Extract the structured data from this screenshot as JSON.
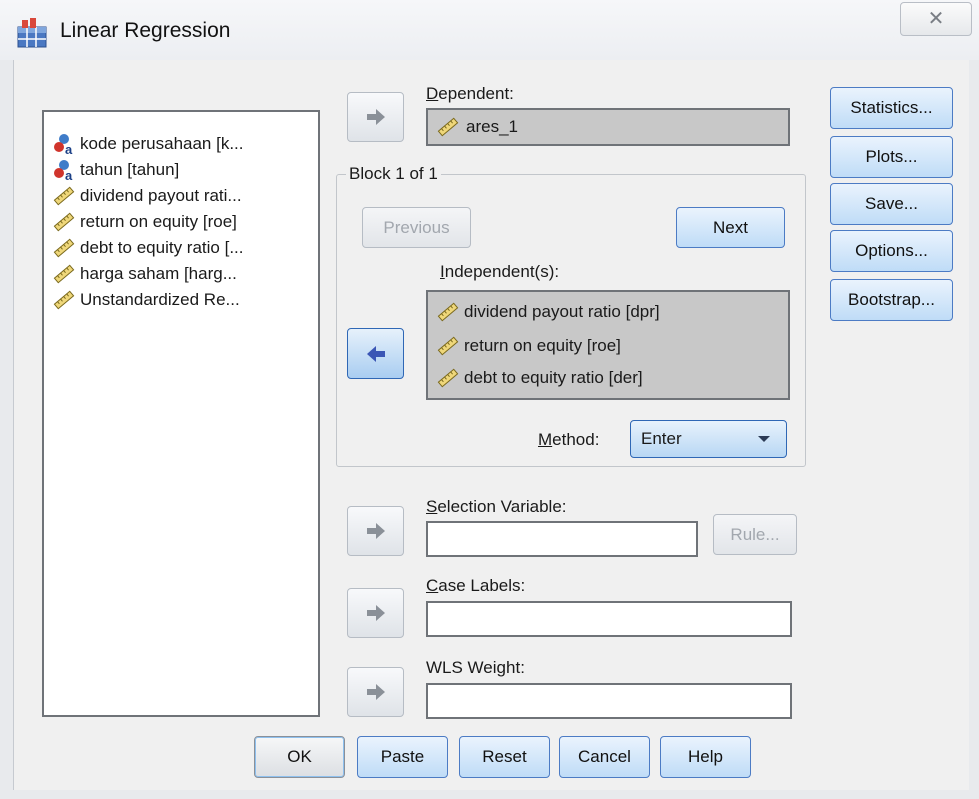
{
  "window": {
    "title": "Linear Regression",
    "close_glyph": "✕"
  },
  "variables": [
    {
      "label": "kode perusahaan [k...",
      "icon": "nominal-icon"
    },
    {
      "label": "tahun [tahun]",
      "icon": "nominal-icon"
    },
    {
      "label": "dividend payout rati...",
      "icon": "scale-ruler-icon"
    },
    {
      "label": "return on equity [roe]",
      "icon": "scale-ruler-icon"
    },
    {
      "label": "debt to equity ratio [...",
      "icon": "scale-ruler-icon"
    },
    {
      "label": "harga saham [harg...",
      "icon": "scale-ruler-icon"
    },
    {
      "label": "Unstandardized Re...",
      "icon": "scale-ruler-icon"
    }
  ],
  "dependent": {
    "label": "Dependent:",
    "value": "ares_1"
  },
  "block": {
    "title": "Block 1 of 1",
    "previous_label": "Previous",
    "next_label": "Next"
  },
  "independents": {
    "label": "Independent(s):",
    "items": [
      "dividend payout ratio [dpr]",
      "return on equity [roe]",
      "debt to equity ratio [der]"
    ]
  },
  "method": {
    "label": "Method:",
    "selected": "Enter"
  },
  "selection_variable": {
    "label": "Selection Variable:",
    "value": "",
    "rule_label": "Rule..."
  },
  "case_labels": {
    "label": "Case Labels:",
    "value": ""
  },
  "wls_weight": {
    "label": "WLS Weight:",
    "value": ""
  },
  "side_buttons": {
    "statistics": "Statistics...",
    "plots": "Plots...",
    "save": "Save...",
    "options": "Options...",
    "bootstrap": "Bootstrap..."
  },
  "bottom_buttons": {
    "ok": "OK",
    "paste": "Paste",
    "reset": "Reset",
    "cancel": "Cancel",
    "help": "Help"
  },
  "colors": {
    "accent_button": "#bfdcf7",
    "filled_field": "#c8c8c8",
    "dialog_bg": "#f0f0f0"
  }
}
